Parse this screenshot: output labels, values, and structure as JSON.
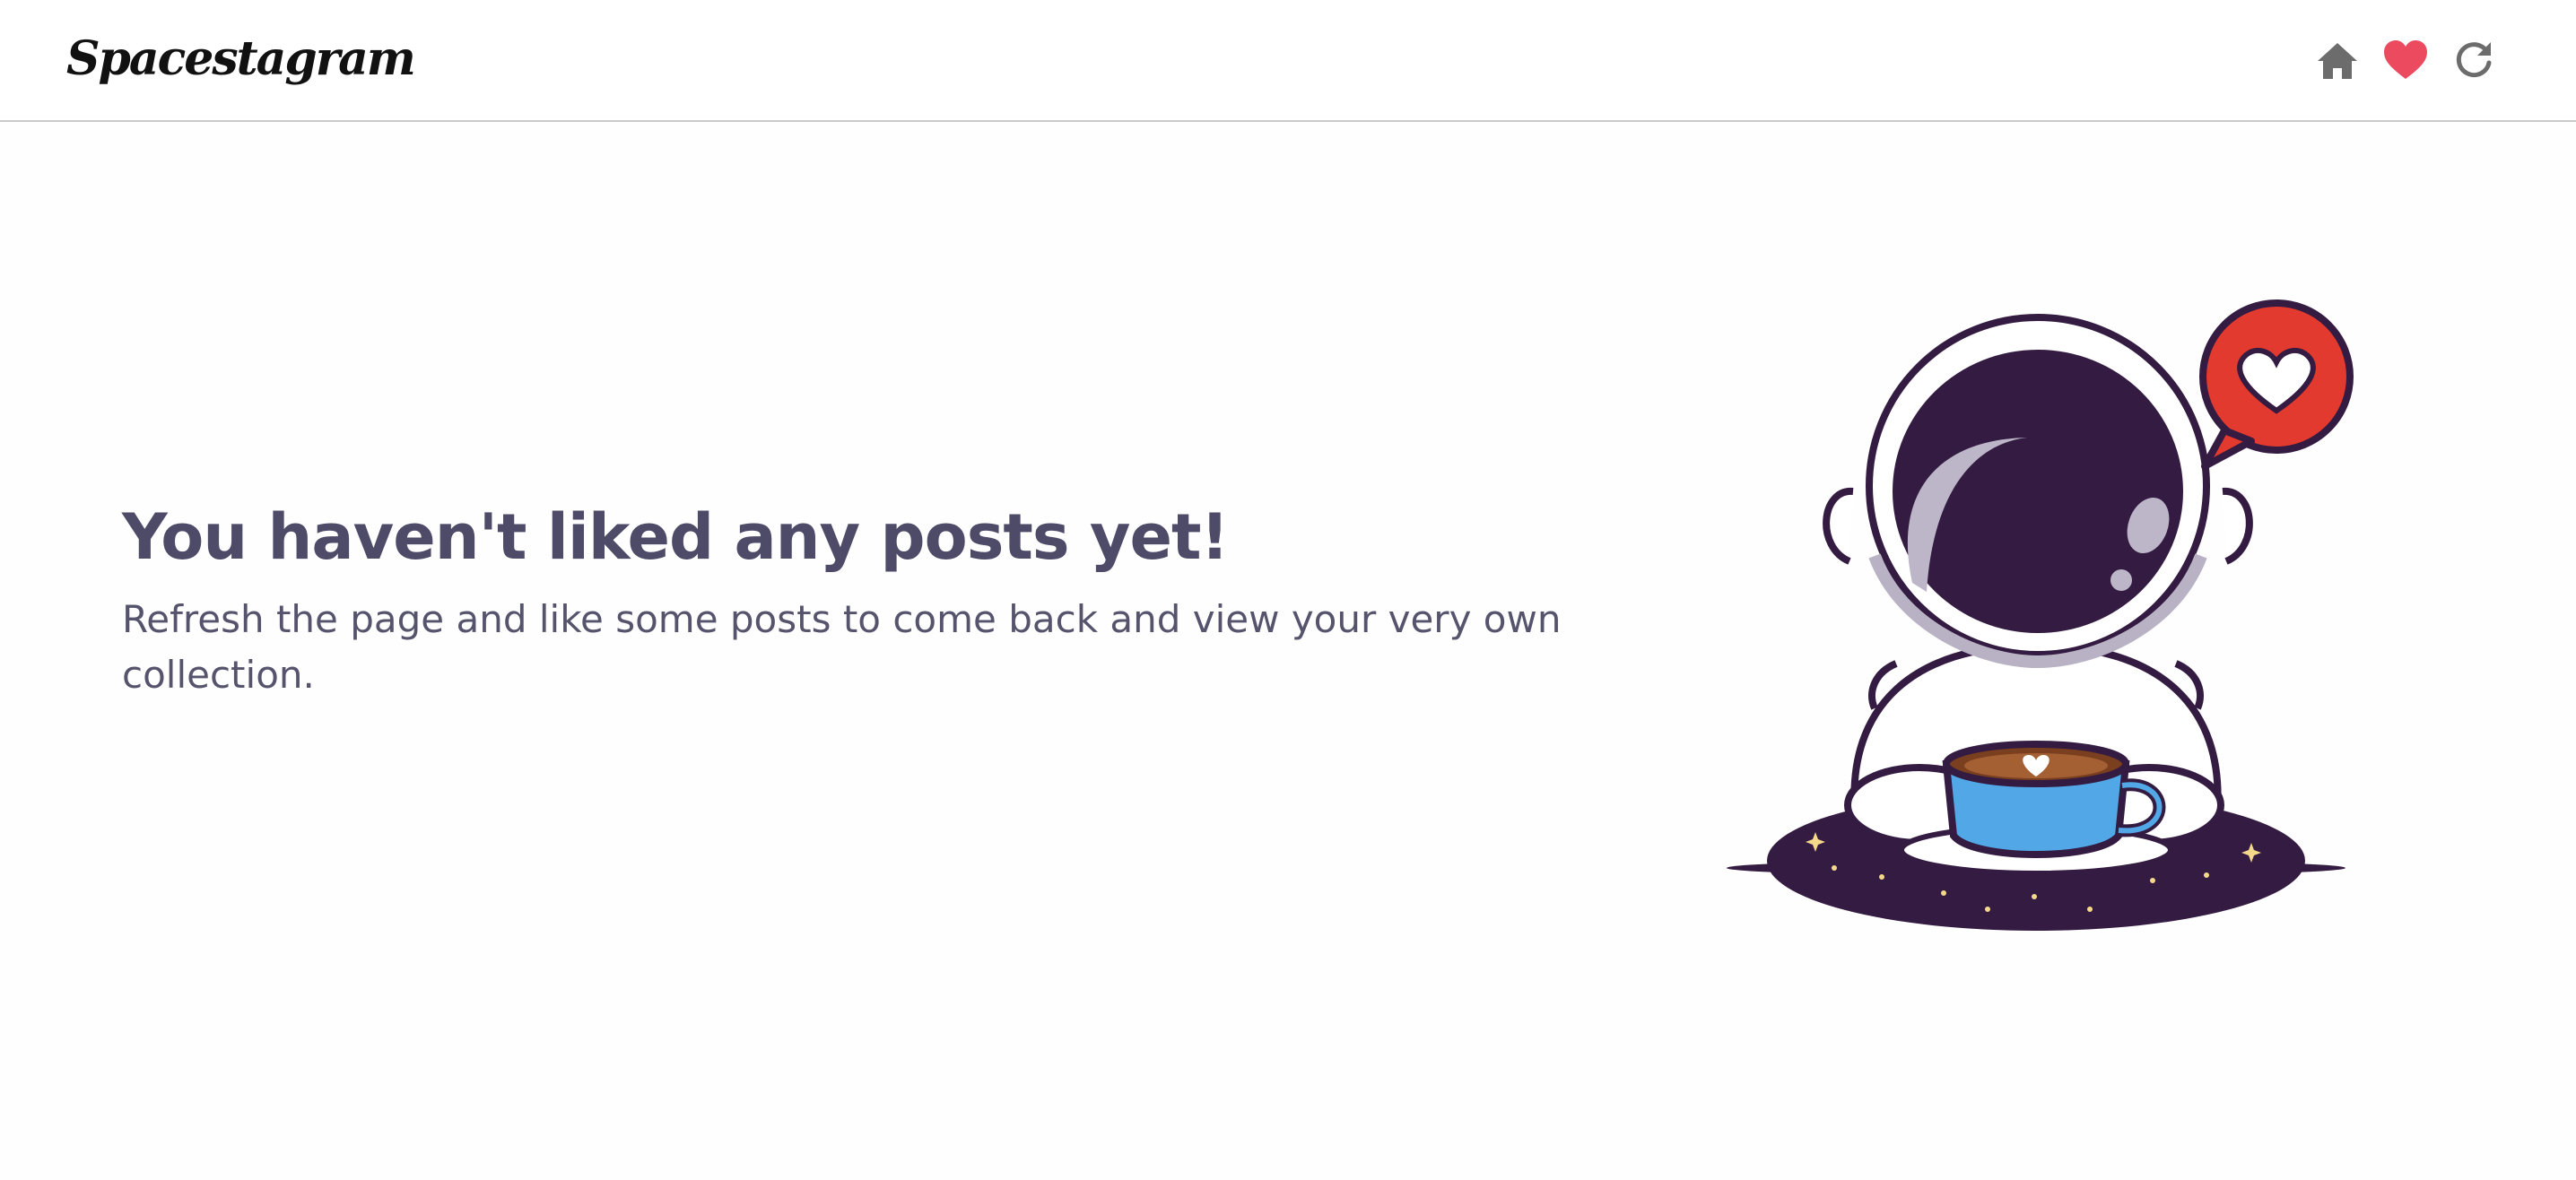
{
  "header": {
    "logo_text": "Spacestagram",
    "nav": [
      {
        "name": "home",
        "icon": "home-icon"
      },
      {
        "name": "liked",
        "icon": "heart-icon",
        "active": true
      },
      {
        "name": "refresh",
        "icon": "refresh-icon"
      }
    ]
  },
  "empty_state": {
    "title": "You haven't liked any posts yet!",
    "subtitle": "Refresh the page and like some posts to come back and view your very own collection."
  },
  "colors": {
    "heart_active": "#ec4a5f",
    "icon_gray": "#6c6c6c",
    "title_text": "#4d4b68",
    "body_text": "#56546d",
    "astronaut_helmet": "#331b41",
    "speech_bubble": "#e23a2e",
    "mug": "#52a8e6"
  },
  "illustration": {
    "icon": "astronaut-coffee-heart-illustration"
  }
}
